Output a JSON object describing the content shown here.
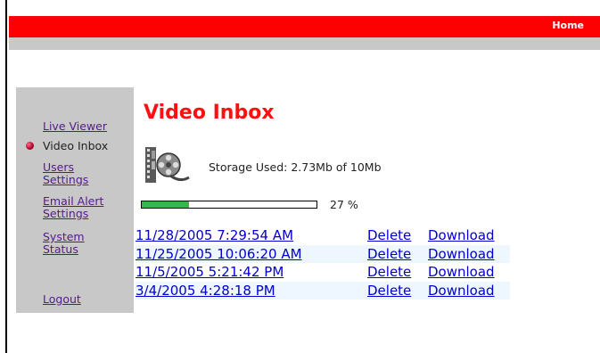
{
  "header": {
    "home_label": "Home"
  },
  "sidebar": {
    "items": [
      {
        "label": "Live Viewer"
      },
      {
        "label": "Video Inbox",
        "current": true
      },
      {
        "label": "Users"
      },
      {
        "label": "Settings"
      },
      {
        "label": "Email Alert"
      },
      {
        "label": "Settings"
      },
      {
        "label": "System"
      },
      {
        "label": "Status"
      },
      {
        "label": "Logout"
      }
    ]
  },
  "main": {
    "title": "Video Inbox",
    "storage_text": "Storage Used: 2.73Mb of 10Mb",
    "progress": {
      "percent_value": 27,
      "percent_label": "27 %"
    },
    "recordings": [
      {
        "date": "11/28/2005 7:29:54 AM",
        "delete": "Delete",
        "download": "Download"
      },
      {
        "date": "11/25/2005 10:06:20 AM",
        "delete": "Delete",
        "download": "Download"
      },
      {
        "date": "11/5/2005 5:21:42 PM",
        "delete": "Delete",
        "download": "Download"
      },
      {
        "date": "3/4/2005 4:28:18 PM",
        "delete": "Delete",
        "download": "Download"
      }
    ]
  },
  "colors": {
    "brand_red": "#ff0000",
    "sidebar_gray": "#c8c8c8",
    "link_blue": "#0000cc",
    "visited_purple": "#551a8b",
    "progress_green": "#39b54a"
  },
  "icons": {
    "bullet": "red-bullet-icon",
    "film": "film-reel-icon"
  }
}
